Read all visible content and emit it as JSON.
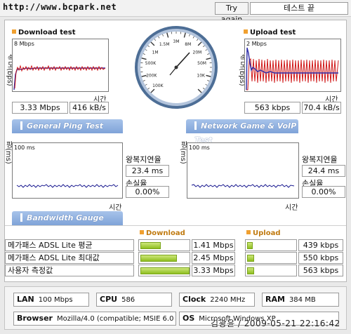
{
  "header": {
    "url": "http://www.bcpark.net",
    "try_again": "Try again",
    "status": "테스트 끝"
  },
  "download": {
    "title": "Download test",
    "y_axis": "속도(bps)",
    "scale": "8 Mbps",
    "x_axis": "시간",
    "mbps": "3.33 Mbps",
    "kbs": "416 kB/s"
  },
  "upload": {
    "title": "Upload test",
    "y_axis": "속도(bps)",
    "scale": "2 Mbps",
    "x_axis": "시간",
    "kbps": "563 kbps",
    "kbs": "70.4 kB/s"
  },
  "gauge": {
    "labels": [
      "100K",
      "200K",
      "500K",
      "1M",
      "1.5M",
      "3M",
      "8M",
      "20M",
      "50M",
      "10K"
    ]
  },
  "ping": {
    "banner": "General Ping Test",
    "y_axis": "핑(ms)",
    "scale": "100 ms",
    "x_axis": "시간",
    "rtt_label": "왕복지연율",
    "rtt_value": "23.4 ms",
    "loss_label": "손실율",
    "loss_value": "0.00%"
  },
  "game": {
    "banner": "Network Game & VoIP Test",
    "y_axis": "핑(ms)",
    "scale": "100 ms",
    "x_axis": "시간",
    "rtt_label": "왕복지연율",
    "rtt_value": "24.4 ms",
    "loss_label": "손실율",
    "loss_value": "0.00%"
  },
  "bandwidth": {
    "banner": "Bandwidth Gauge",
    "download_header": "Download",
    "upload_header": "Upload",
    "rows": [
      {
        "label": "메가패스 ADSL Lite 평균",
        "download": "1.41 Mbps",
        "download_fill": 0.42,
        "upload": "439 kbps",
        "upload_fill": 0.12
      },
      {
        "label": "메가패스 ADSL Lite 최대값",
        "download": "2.45 Mbps",
        "download_fill": 0.74,
        "upload": "550 kbps",
        "upload_fill": 0.14
      },
      {
        "label": "사용자 측정값",
        "download": "3.33 Mbps",
        "download_fill": 1.0,
        "upload": "563 kbps",
        "upload_fill": 0.14
      }
    ]
  },
  "system": {
    "lan_label": "LAN",
    "lan_value": "100 Mbps",
    "cpu_label": "CPU",
    "cpu_value": "586",
    "clock_label": "Clock",
    "clock_value": "2240 MHz",
    "ram_label": "RAM",
    "ram_value": "384 MB",
    "browser_label": "Browser",
    "browser_value": "Mozilla/4.0 (compatible; MSIE 6.0",
    "os_label": "OS",
    "os_value": "Microsoft Windows XP"
  },
  "watermark": "김광윤 / 2009-05-21 22:16:42",
  "colors": {
    "download_line": "#2c2ca8",
    "upload_line": "#d01818",
    "ping_line": "#1a1a90",
    "banner": "#8fb0e0",
    "bar_fill": "#a8d040",
    "bullet": "#f0a030"
  }
}
